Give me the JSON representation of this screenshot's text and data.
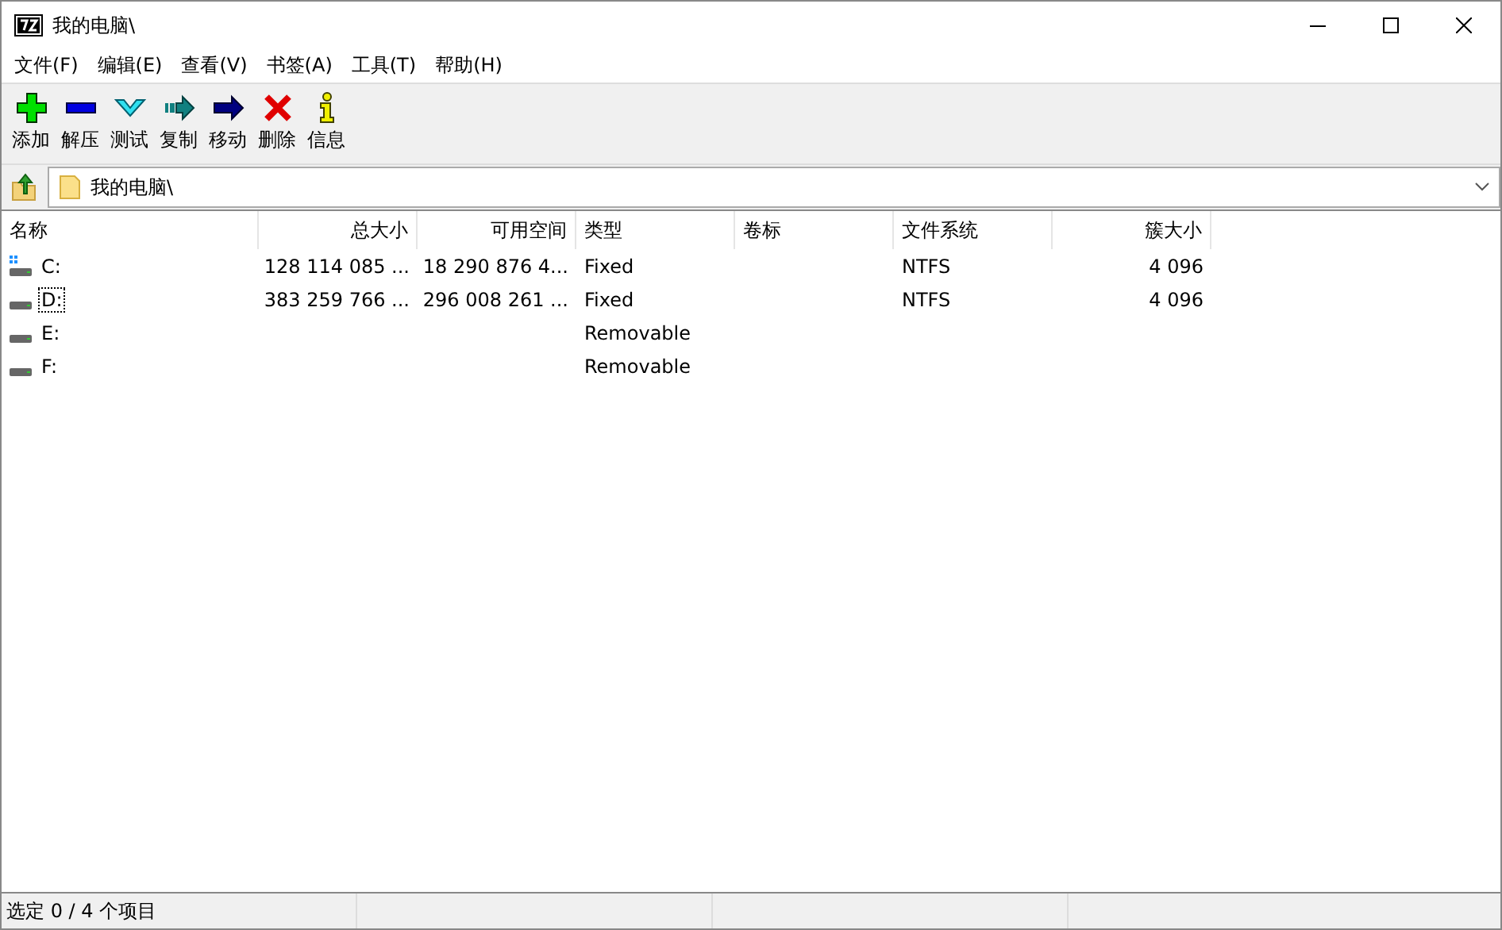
{
  "window": {
    "title": "我的电脑\\"
  },
  "menu": [
    "文件(F)",
    "编辑(E)",
    "查看(V)",
    "书签(A)",
    "工具(T)",
    "帮助(H)"
  ],
  "toolbar": [
    {
      "label": "添加",
      "kind": "add"
    },
    {
      "label": "解压",
      "kind": "extract"
    },
    {
      "label": "测试",
      "kind": "test"
    },
    {
      "label": "复制",
      "kind": "copy"
    },
    {
      "label": "移动",
      "kind": "move"
    },
    {
      "label": "删除",
      "kind": "delete"
    },
    {
      "label": "信息",
      "kind": "info"
    }
  ],
  "address": {
    "value": "我的电脑\\"
  },
  "table": {
    "columns": [
      "名称",
      "总大小",
      "可用空间",
      "类型",
      "卷标",
      "文件系统",
      "簇大小"
    ],
    "rows": [
      {
        "kind": "system",
        "focused": false,
        "cells": [
          "C:",
          "128 114 085 ...",
          "18 290 876 4...",
          "Fixed",
          "",
          "NTFS",
          "4 096"
        ]
      },
      {
        "kind": "drive",
        "focused": true,
        "cells": [
          "D:",
          "383 259 766 ...",
          "296 008 261 ...",
          "Fixed",
          "",
          "NTFS",
          "4 096"
        ]
      },
      {
        "kind": "drive",
        "focused": false,
        "cells": [
          "E:",
          "",
          "",
          "Removable",
          "",
          "",
          ""
        ]
      },
      {
        "kind": "drive",
        "focused": false,
        "cells": [
          "F:",
          "",
          "",
          "Removable",
          "",
          "",
          ""
        ]
      }
    ]
  },
  "status_bar": [
    "选定 0 / 4 个项目"
  ]
}
